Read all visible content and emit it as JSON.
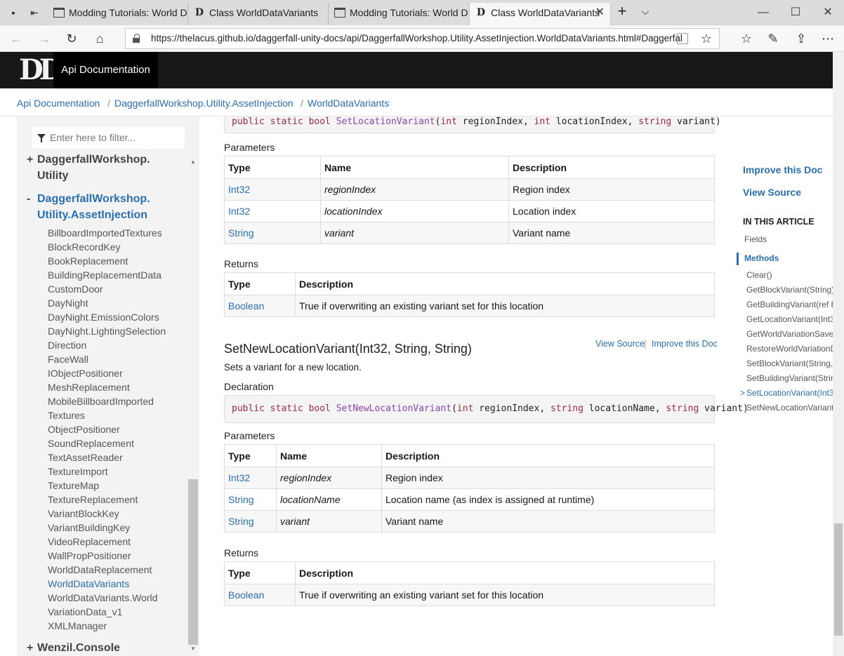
{
  "browser": {
    "tabs": [
      {
        "title": "Modding Tutorials: World D",
        "favicon": "page-icon",
        "active": false
      },
      {
        "title": "Class WorldDataVariants",
        "favicon": "daggerfall-d-icon",
        "active": false
      },
      {
        "title": "Modding Tutorials: World D",
        "favicon": "page-icon",
        "active": false
      },
      {
        "title": "Class WorldDataVariants",
        "favicon": "daggerfall-d-icon",
        "active": true
      }
    ],
    "new_tab_label": "+",
    "tab_list_label": "⌵",
    "close_tab_label": "✕",
    "window": {
      "minimize": "—",
      "maximize": "☐",
      "close": "✕"
    },
    "url": "https://thelacus.github.io/daggerfall-unity-docs/api/DaggerfallWorkshop.Utility.AssetInjection.WorldDataVariants.html#Daggerfal"
  },
  "site": {
    "logo": "D",
    "title": "Api Documentation"
  },
  "breadcrumb": [
    "Api Documentation",
    "DaggerfallWorkshop.Utility.AssetInjection",
    "WorldDataVariants"
  ],
  "breadcrumb_separator": "/",
  "toc": {
    "filter_placeholder": "Enter here to filter...",
    "namespaces": [
      {
        "toggle": "+",
        "line1": "DaggerfallWorkshop.",
        "line2": "Utility"
      },
      {
        "toggle": "-",
        "line1": "DaggerfallWorkshop.",
        "line2": "Utility.AssetInjection"
      }
    ],
    "items": [
      "BillboardImportedTextures",
      "BlockRecordKey",
      "BookReplacement",
      "BuildingReplacementData",
      "CustomDoor",
      "DayNight",
      "DayNight.EmissionColors",
      "DayNight.LightingSelection",
      "Direction",
      "FaceWall",
      "IObjectPositioner",
      "MeshReplacement",
      "MobileBillboardImported",
      "Textures",
      "ObjectPositioner",
      "SoundReplacement",
      "TextAssetReader",
      "TextureImport",
      "TextureMap",
      "TextureReplacement",
      "VariantBlockKey",
      "VariantBuildingKey",
      "VideoReplacement",
      "WallPropPositioner",
      "WorldDataReplacement",
      "WorldDataVariants",
      "WorldDataVariants.World",
      "VariationData_v1",
      "XMLManager"
    ],
    "active_item": "WorldDataVariants",
    "last_namespace": {
      "toggle": "+",
      "label": "Wenzil.Console"
    }
  },
  "content": {
    "decl1": {
      "kw": "public static bool",
      "fn": "SetLocationVariant",
      "p1t": "int",
      "p1": "regionIndex,",
      "p2t": "int",
      "p2": "locationIndex,",
      "p3t": "string",
      "p3": "variant"
    },
    "params_label": "Parameters",
    "returns_label": "Returns",
    "declaration_label": "Declaration",
    "headers": {
      "type": "Type",
      "name": "Name",
      "description": "Description"
    },
    "params1": [
      {
        "type": "Int32",
        "name": "regionIndex",
        "description": "Region index"
      },
      {
        "type": "Int32",
        "name": "locationIndex",
        "description": "Location index"
      },
      {
        "type": "String",
        "name": "variant",
        "description": "Variant name"
      }
    ],
    "returns1": {
      "type": "Boolean",
      "description": "True if overwriting an existing variant set for this location"
    },
    "method2": {
      "title": "SetNewLocationVariant(Int32, String, String)",
      "view_source": "View Source",
      "improve_doc": "Improve this Doc",
      "summary": "Sets a variant for a new location.",
      "decl": {
        "kw": "public static bool",
        "fn": "SetNewLocationVariant",
        "p1t": "int",
        "p1": "regionIndex,",
        "p2t": "string",
        "p2": "locationName,",
        "p3t": "string",
        "p3": "variant"
      }
    },
    "params2": [
      {
        "type": "Int32",
        "name": "regionIndex",
        "description": "Region index"
      },
      {
        "type": "String",
        "name": "locationName",
        "description": "Location name (as index is assigned at runtime)"
      },
      {
        "type": "String",
        "name": "variant",
        "description": "Variant name"
      }
    ],
    "returns2": {
      "type": "Boolean",
      "description": "True if overwriting an existing variant set for this location"
    }
  },
  "affix": {
    "improve": "Improve this Doc",
    "view_source": "View Source",
    "heading": "IN THIS ARTICLE",
    "sections": [
      "Fields",
      "Methods"
    ],
    "methods": [
      "Clear()",
      "GetBlockVariant(String)",
      "GetBuildingVariant(ref B",
      "GetLocationVariant(Int3",
      "GetWorldVariationSave",
      "RestoreWorldVariationD",
      "SetBlockVariant(String,",
      "SetBuildingVariant(Strin",
      "SetLocationVariant(Int3",
      "SetNewLocationVariant"
    ],
    "active_method": "SetLocationVariant(Int3",
    "active_marker": ">"
  }
}
